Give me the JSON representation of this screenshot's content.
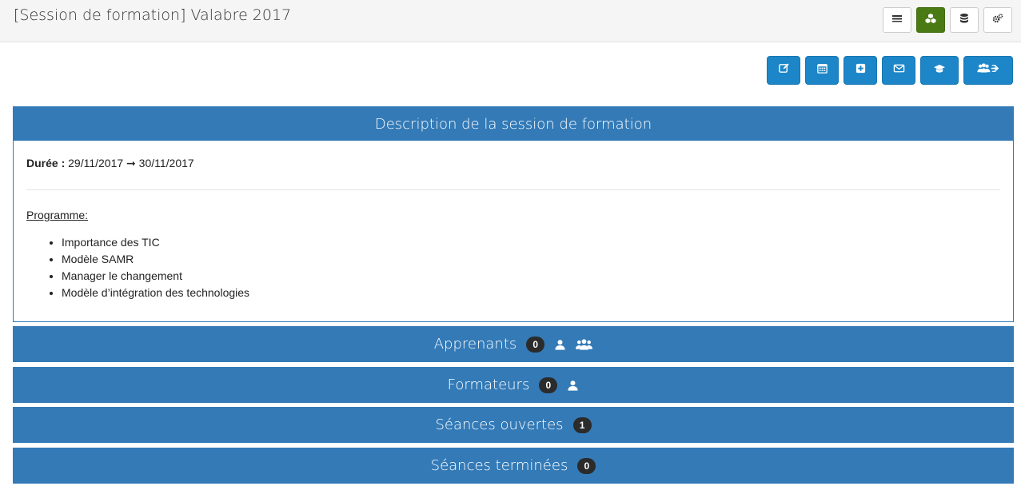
{
  "header": {
    "title": "[Session de formation] Valabre 2017",
    "tools": [
      {
        "icon": "list-icon"
      },
      {
        "icon": "cubes-icon",
        "active": true
      },
      {
        "icon": "database-icon"
      },
      {
        "icon": "cogs-icon"
      }
    ]
  },
  "actions": [
    {
      "icon": "edit-icon"
    },
    {
      "icon": "calendar-icon"
    },
    {
      "icon": "plus-square-icon"
    },
    {
      "icon": "envelope-icon"
    },
    {
      "icon": "graduation-cap-icon"
    },
    {
      "icon": "users-exit-icon"
    }
  ],
  "description": {
    "heading": "Description de la session de formation",
    "duree_label": "Durée :",
    "duree_value": "29/11/2017 ➞ 30/11/2017",
    "programme_label": "Programme:",
    "items": [
      "Importance des TIC",
      "Modèle SAMR",
      "Manager le changement",
      "Modèle d’intégration des technologies"
    ]
  },
  "sections": {
    "apprenants": {
      "label": "Apprenants",
      "count": "0"
    },
    "formateurs": {
      "label": "Formateurs",
      "count": "0"
    },
    "seances_ouvertes": {
      "label": "Séances ouvertes",
      "count": "1"
    },
    "seances_terminees": {
      "label": "Séances terminées",
      "count": "0"
    }
  },
  "colors": {
    "primary": "#337ab7",
    "action": "#1c86c8",
    "active_tool": "#4a7a14",
    "badge": "#2b2b2b"
  }
}
